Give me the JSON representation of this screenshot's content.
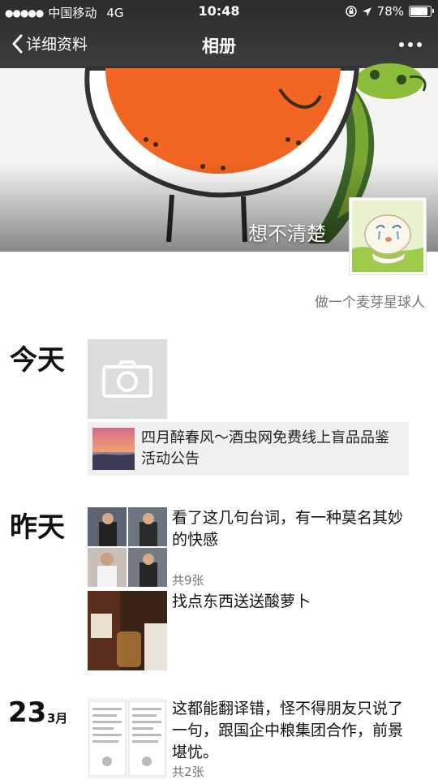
{
  "status": {
    "carrier": "中国移动",
    "network": "4G",
    "time": "10:48",
    "battery": "78%",
    "icons": [
      "signal-dots-icon",
      "lock-rotation-icon",
      "location-arrow-icon",
      "battery-icon"
    ]
  },
  "nav": {
    "back_label": "详细资料",
    "title": "相册",
    "icons": [
      "chevron-left-icon",
      "more-icon"
    ]
  },
  "profile": {
    "nickname": "想不清楚",
    "signature": "做一个麦芽星球人"
  },
  "timeline": {
    "today": {
      "date": "今天",
      "share_title": "四月醉春风～酒虫网免费线上盲品品鉴活动公告",
      "icons": [
        "camera-icon"
      ]
    },
    "yesterday": {
      "date": "昨天",
      "posts": [
        {
          "text": "看了这几句台词，有一种莫名其妙的快感",
          "count": "共9张"
        },
        {
          "text": "找点东西送送酸萝卜"
        }
      ]
    },
    "mar23": {
      "day": "23",
      "month": "3月",
      "post": {
        "text": "这都能翻译错，怪不得朋友只说了一句，跟国企中粮集团合作，前景堪忧。",
        "count": "共2张"
      }
    }
  },
  "colors": {
    "nav_bg": "#333333",
    "cover_orange": "#f26522",
    "cover_green": "#7aa832",
    "muted_text": "#777777"
  }
}
